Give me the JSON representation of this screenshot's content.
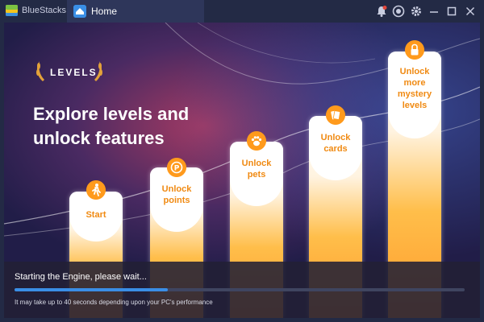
{
  "window": {
    "app_name": "BlueStacks",
    "tab_label": "Home"
  },
  "hero": {
    "badge": "LEVELS",
    "headline_line1": "Explore levels and",
    "headline_line2": "unlock features"
  },
  "pillars": [
    {
      "label_lines": [
        "Start"
      ],
      "icon": "person-walking-icon"
    },
    {
      "label_lines": [
        "Unlock",
        "points"
      ],
      "icon": "points-coin-icon"
    },
    {
      "label_lines": [
        "Unlock",
        "pets"
      ],
      "icon": "paw-icon"
    },
    {
      "label_lines": [
        "Unlock",
        "cards"
      ],
      "icon": "cards-icon"
    },
    {
      "label_lines": [
        "Unlock",
        "more",
        "mystery",
        "levels"
      ],
      "icon": "lock-icon"
    }
  ],
  "loading": {
    "status": "Starting the Engine, please wait...",
    "note": "It may take up to 40 seconds depending upon your PC's performance",
    "progress_fraction": 0.34
  },
  "colors": {
    "accent": "#3a8ee6",
    "pillar_orange": "#f08a12",
    "titlebar": "#232a45"
  }
}
